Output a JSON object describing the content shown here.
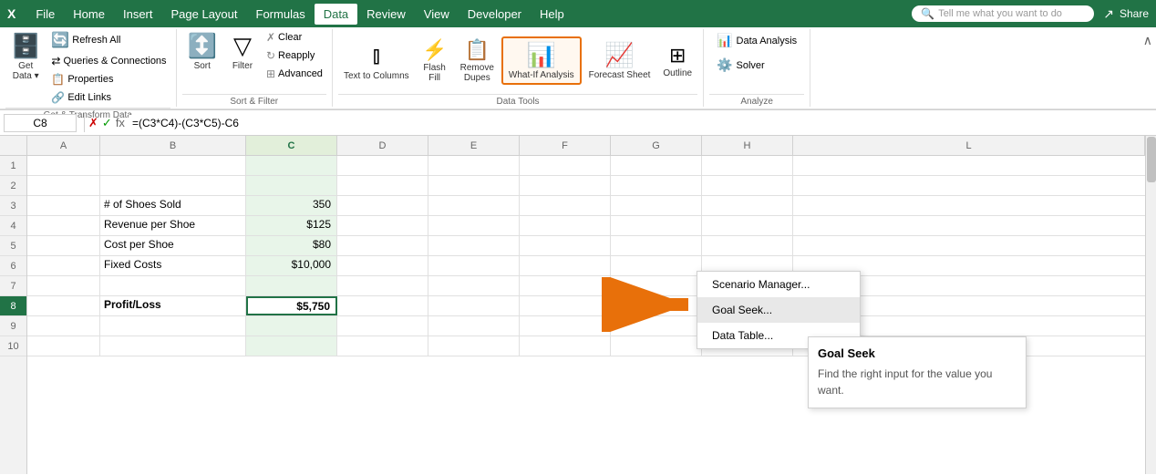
{
  "app": {
    "title": "Excel"
  },
  "menu": {
    "items": [
      "File",
      "Home",
      "Insert",
      "Page Layout",
      "Formulas",
      "Data",
      "Review",
      "View",
      "Developer",
      "Help"
    ],
    "active": "Data",
    "search_placeholder": "Tell me what you want to do",
    "share_label": "Share"
  },
  "ribbon": {
    "get_data_label": "Get & Transform Data",
    "get_data_btn": "Get\nData",
    "refresh_all_btn": "Refresh\nAll",
    "queries_connections_group": "Queries & Connections",
    "queries_btn": "Queries & Connections",
    "properties_btn": "Properties",
    "edit_links_btn": "Edit Links",
    "sort_filter_group": "Sort & Filter",
    "sort_btn": "Sort",
    "filter_btn": "Filter",
    "clear_btn": "Clear",
    "reapply_btn": "Reapply",
    "advanced_btn": "Advanced",
    "data_tools_group": "Data Tools",
    "text_columns_btn": "Text to\nColumns",
    "what_if_btn": "What-If\nAnalysis",
    "forecast_btn": "Forecast\nSheet",
    "outline_btn": "Outline",
    "analyze_group": "Analyze",
    "data_analysis_btn": "Data Analysis",
    "solver_btn": "Solver"
  },
  "formula_bar": {
    "cell_ref": "C8",
    "formula": "=(C3*C4)-(C3*C5)-C6"
  },
  "columns": [
    "A",
    "B",
    "C",
    "D",
    "E",
    "F",
    "G",
    "H",
    "L"
  ],
  "rows": [
    {
      "num": 1,
      "cells": [
        "",
        "",
        "",
        "",
        "",
        "",
        "",
        ""
      ]
    },
    {
      "num": 2,
      "cells": [
        "",
        "",
        "",
        "",
        "",
        "",
        "",
        ""
      ]
    },
    {
      "num": 3,
      "cells": [
        "",
        "# of Shoes Sold",
        "350",
        "",
        "",
        "",
        "",
        ""
      ]
    },
    {
      "num": 4,
      "cells": [
        "",
        "Revenue per Shoe",
        "$125",
        "",
        "",
        "",
        "",
        ""
      ]
    },
    {
      "num": 5,
      "cells": [
        "",
        "Cost per Shoe",
        "$80",
        "",
        "",
        "",
        "",
        ""
      ]
    },
    {
      "num": 6,
      "cells": [
        "",
        "Fixed Costs",
        "$10,000",
        "",
        "",
        "",
        "",
        ""
      ]
    },
    {
      "num": 7,
      "cells": [
        "",
        "",
        "",
        "",
        "",
        "",
        "",
        ""
      ]
    },
    {
      "num": 8,
      "cells": [
        "",
        "Profit/Loss",
        "$5,750",
        "",
        "",
        "",
        "",
        ""
      ],
      "selected": true,
      "bold_b": true
    },
    {
      "num": 9,
      "cells": [
        "",
        "",
        "",
        "",
        "",
        "",
        "",
        ""
      ]
    },
    {
      "num": 10,
      "cells": [
        "",
        "",
        "",
        "",
        "",
        "",
        "",
        ""
      ]
    }
  ],
  "dropdown": {
    "items": [
      "Scenario Manager...",
      "Goal Seek...",
      "Data Table..."
    ],
    "active": "Goal Seek..."
  },
  "tooltip": {
    "title": "Goal Seek",
    "text": "Find the right input for the value you want."
  }
}
